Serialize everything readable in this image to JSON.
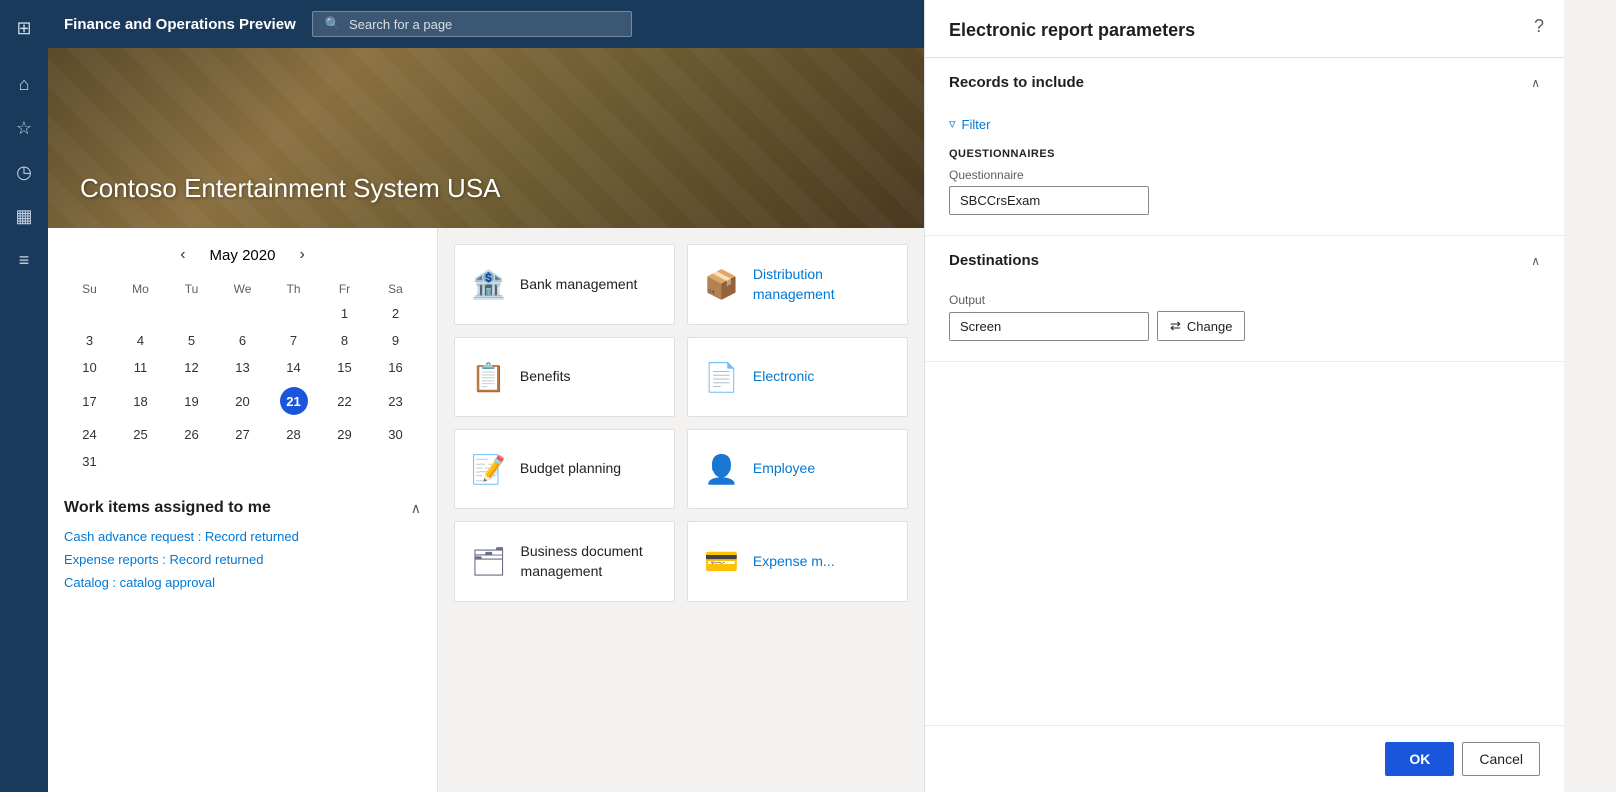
{
  "topbar": {
    "app_name": "Finance and Operations Preview",
    "search_placeholder": "Search for a page"
  },
  "hero": {
    "company_name": "Contoso Entertainment System USA"
  },
  "sidebar": {
    "icons": [
      {
        "name": "grid-icon",
        "symbol": "⊞"
      },
      {
        "name": "home-icon",
        "symbol": "⌂"
      },
      {
        "name": "star-icon",
        "symbol": "☆"
      },
      {
        "name": "clock-icon",
        "symbol": "○"
      },
      {
        "name": "workspace-icon",
        "symbol": "▦"
      },
      {
        "name": "list-icon",
        "symbol": "≡"
      }
    ]
  },
  "calendar": {
    "month": "May",
    "year": "2020",
    "weekdays": [
      "Su",
      "Mo",
      "Tu",
      "We",
      "Th",
      "Fr",
      "Sa"
    ],
    "weeks": [
      [
        "",
        "",
        "",
        "",
        "",
        "1",
        "2"
      ],
      [
        "3",
        "4",
        "5",
        "6",
        "7",
        "8",
        "9"
      ],
      [
        "10",
        "11",
        "12",
        "13",
        "14",
        "15",
        "16"
      ],
      [
        "17",
        "18",
        "19",
        "20",
        "21",
        "22",
        "23"
      ],
      [
        "24",
        "25",
        "26",
        "27",
        "28",
        "29",
        "30"
      ],
      [
        "31",
        "",
        "",
        "",
        "",
        "",
        ""
      ]
    ],
    "today": "21",
    "today_col": 4,
    "today_row": 3
  },
  "work_items": {
    "title": "Work items assigned to me",
    "collapse_label": "^",
    "items": [
      {
        "text": "Cash advance request : Record returned"
      },
      {
        "text": "Expense reports : Record returned"
      },
      {
        "text": "Catalog : catalog approval"
      }
    ]
  },
  "tiles": [
    {
      "id": "bank-management",
      "label": "Bank management",
      "icon": "🏦"
    },
    {
      "id": "distribution-management",
      "label": "Distribution management",
      "icon": "📦",
      "truncated": true
    },
    {
      "id": "benefits",
      "label": "Benefits",
      "icon": "📋"
    },
    {
      "id": "electronic",
      "label": "Electronic",
      "icon": "📄",
      "truncated": true
    },
    {
      "id": "budget-planning",
      "label": "Budget planning",
      "icon": "📝"
    },
    {
      "id": "employee",
      "label": "Employee",
      "icon": "👤",
      "truncated": true
    },
    {
      "id": "business-document",
      "label": "Business document management",
      "icon": "🗂"
    },
    {
      "id": "expense",
      "label": "Expense m...",
      "icon": "💳",
      "truncated": true
    }
  ],
  "right_panel": {
    "title": "Electronic report parameters",
    "help_icon": "?",
    "sections": [
      {
        "id": "records-to-include",
        "title": "Records to include",
        "expanded": true,
        "filter_label": "Filter",
        "questionnaires_label": "QUESTIONNAIRES",
        "questionnaire_field_label": "Questionnaire",
        "questionnaire_value": "SBCCrsExam"
      },
      {
        "id": "destinations",
        "title": "Destinations",
        "expanded": true,
        "output_label": "Output",
        "output_value": "Screen",
        "change_button_label": "Change",
        "change_icon": "⇄"
      }
    ],
    "footer": {
      "ok_label": "OK",
      "cancel_label": "Cancel"
    }
  }
}
